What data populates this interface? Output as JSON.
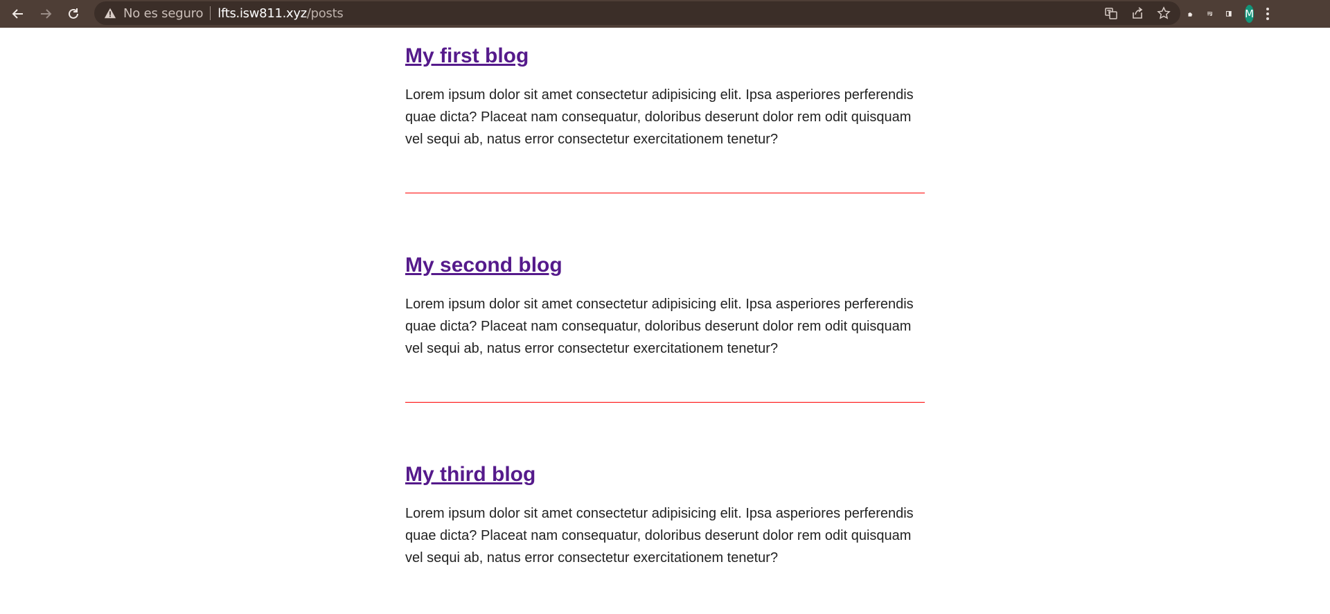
{
  "browser": {
    "security_text": "No es seguro",
    "url_host": "lfts.isw811.xyz",
    "url_path": "/posts",
    "avatar_letter": "M",
    "avatar_color": "#13957a",
    "toolbar_color": "#4e3e36",
    "icons": [
      "back-icon",
      "forward-icon",
      "reload-icon",
      "warning-icon",
      "translate-icon",
      "share-icon",
      "star-icon",
      "extensions-icon",
      "reading-list-icon",
      "side-panel-icon",
      "menu-icon"
    ]
  },
  "posts": [
    {
      "title": "My first blog",
      "body": "Lorem ipsum dolor sit amet consectetur adipisicing elit. Ipsa asperiores perferendis quae dicta? Placeat nam consequatur, doloribus deserunt dolor rem odit quisquam vel sequi ab, natus error consectetur exercitationem tenetur?"
    },
    {
      "title": "My second blog",
      "body": "Lorem ipsum dolor sit amet consectetur adipisicing elit. Ipsa asperiores perferendis quae dicta? Placeat nam consequatur, doloribus deserunt dolor rem odit quisquam vel sequi ab, natus error consectetur exercitationem tenetur?"
    },
    {
      "title": "My third blog",
      "body": "Lorem ipsum dolor sit amet consectetur adipisicing elit. Ipsa asperiores perferendis quae dicta? Placeat nam consequatur, doloribus deserunt dolor rem odit quisquam vel sequi ab, natus error consectetur exercitationem tenetur?"
    }
  ],
  "colors": {
    "link": "#551a8b",
    "divider": "#ff0000",
    "text": "#222222"
  }
}
